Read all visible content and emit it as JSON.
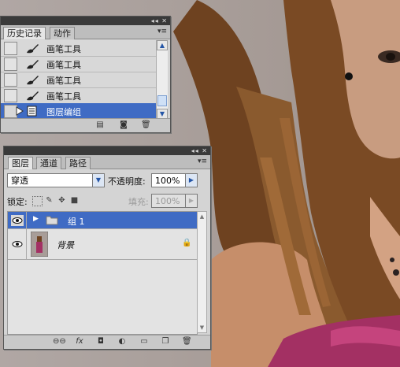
{
  "history_panel": {
    "tabs": [
      {
        "label": "历史记录",
        "active": true
      },
      {
        "label": "动作",
        "active": false
      }
    ],
    "items": [
      {
        "label": "画笔工具",
        "icon": "brush-icon",
        "selected": false
      },
      {
        "label": "画笔工具",
        "icon": "brush-icon",
        "selected": false
      },
      {
        "label": "画笔工具",
        "icon": "brush-icon",
        "selected": false
      },
      {
        "label": "画笔工具",
        "icon": "brush-icon",
        "selected": false
      },
      {
        "label": "图层编组",
        "icon": "history-state-icon",
        "selected": true
      }
    ],
    "footer_icons": [
      "new-document-icon",
      "snapshot-camera-icon",
      "trash-icon"
    ]
  },
  "layers_panel": {
    "tabs": [
      {
        "label": "图层",
        "active": true
      },
      {
        "label": "通道",
        "active": false
      },
      {
        "label": "路径",
        "active": false
      }
    ],
    "blend_mode": "穿透",
    "opacity_label": "不透明度:",
    "opacity_value": "100%",
    "lock_label": "锁定:",
    "fill_label": "填充:",
    "fill_value": "100%",
    "layers": [
      {
        "name": "组 1",
        "type": "group",
        "selected": true,
        "visible": true
      },
      {
        "name": "背景",
        "type": "image",
        "selected": false,
        "visible": true,
        "locked": true
      }
    ],
    "footer_icons": [
      "link-icon",
      "fx-icon",
      "mask-icon",
      "adjustment-icon",
      "folder-icon",
      "new-layer-icon",
      "trash-icon"
    ]
  },
  "colors": {
    "selection": "#3f6bc4",
    "panel_bg": "#d4d4d4",
    "panel_titlebar": "#3a3a3a"
  }
}
